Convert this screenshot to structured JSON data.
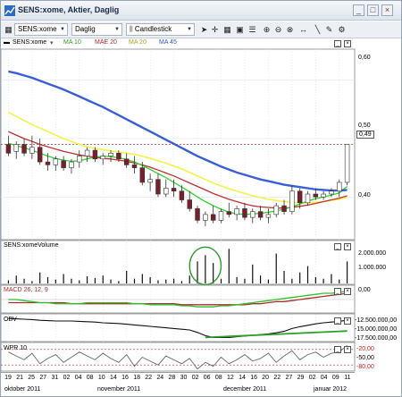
{
  "window": {
    "title": "SENS:xome, Aktier, Daglig",
    "minimize": "_",
    "maximize": "□",
    "close": "×"
  },
  "toolbar": {
    "symbol_value": "SENS:xome",
    "period_value": "Daglig",
    "chart_type_value": "Candlestick",
    "tool_icons": [
      "arrow-cursor-icon",
      "crosshair-icon",
      "grid-icon",
      "save-icon",
      "fields-icon",
      "zoom-in-icon",
      "zoom-out-icon",
      "zoom-fit-icon",
      "pan-icon",
      "trendline-icon",
      "draw-icon",
      "settings-icon"
    ]
  },
  "price_panel": {
    "legend": {
      "symbol": "SENS:xome",
      "ma10": "MA 10",
      "mae20": "MAE 20",
      "ma20": "MA 20",
      "ma45": "MA 45"
    },
    "colors": {
      "ma10": "#2fd22f",
      "mae20": "#c03030",
      "ma20": "#f2f24a",
      "ma45": "#3a5ed6",
      "candle_up": "#ffffff",
      "candle_down": "#7a1f2a",
      "hline": "#c03030"
    },
    "y_labels": [
      "0,60",
      "0,50",
      "0,40"
    ],
    "last_price": "0,49",
    "hline_level": 0.49
  },
  "volume_panel": {
    "label": "SENS:xomeVolume",
    "y_labels": [
      "2.000.000",
      "1.000.000"
    ],
    "highlight_color": "#2a9a2a"
  },
  "macd_panel": {
    "label": "MACD 26, 12, 9",
    "y_labels": [
      "0,00"
    ],
    "colors": {
      "macd": "#30c030",
      "signal": "#a83232"
    }
  },
  "obv_panel": {
    "label": "OBV",
    "y_labels": [
      "-12.500.000,00",
      "-15.000.000,00",
      "-17.500.000,00"
    ]
  },
  "wpr_panel": {
    "label": "WPR 10",
    "y_labels": [
      "-20,00",
      "-50,00",
      "-80,00"
    ]
  },
  "x_axis": {
    "days": [
      "19",
      "21",
      "25",
      "27",
      "31",
      "02",
      "04",
      "08",
      "10",
      "14",
      "16",
      "18",
      "22",
      "24",
      "28",
      "30",
      "02",
      "06",
      "08",
      "12",
      "14",
      "16",
      "20",
      "22",
      "27",
      "29",
      "02",
      "04",
      "09",
      "11"
    ],
    "months": [
      "oktober 2011",
      "november 2011",
      "december 2011",
      "januar 2012"
    ]
  },
  "chart_data": {
    "type": "candlestick",
    "price_ylim": [
      0.33,
      0.65
    ],
    "candles": [
      {
        "o": 0.49,
        "h": 0.505,
        "l": 0.47,
        "c": 0.475
      },
      {
        "o": 0.478,
        "h": 0.495,
        "l": 0.465,
        "c": 0.49
      },
      {
        "o": 0.49,
        "h": 0.5,
        "l": 0.47,
        "c": 0.475
      },
      {
        "o": 0.475,
        "h": 0.505,
        "l": 0.465,
        "c": 0.485
      },
      {
        "o": 0.485,
        "h": 0.5,
        "l": 0.455,
        "c": 0.46
      },
      {
        "o": 0.46,
        "h": 0.475,
        "l": 0.445,
        "c": 0.455
      },
      {
        "o": 0.455,
        "h": 0.47,
        "l": 0.445,
        "c": 0.465
      },
      {
        "o": 0.462,
        "h": 0.47,
        "l": 0.445,
        "c": 0.45
      },
      {
        "o": 0.45,
        "h": 0.465,
        "l": 0.44,
        "c": 0.46
      },
      {
        "o": 0.46,
        "h": 0.48,
        "l": 0.45,
        "c": 0.47
      },
      {
        "o": 0.47,
        "h": 0.485,
        "l": 0.46,
        "c": 0.48
      },
      {
        "o": 0.48,
        "h": 0.485,
        "l": 0.46,
        "c": 0.465
      },
      {
        "o": 0.465,
        "h": 0.475,
        "l": 0.455,
        "c": 0.47
      },
      {
        "o": 0.47,
        "h": 0.48,
        "l": 0.46,
        "c": 0.475
      },
      {
        "o": 0.475,
        "h": 0.48,
        "l": 0.46,
        "c": 0.465
      },
      {
        "o": 0.465,
        "h": 0.475,
        "l": 0.45,
        "c": 0.455
      },
      {
        "o": 0.455,
        "h": 0.47,
        "l": 0.44,
        "c": 0.45
      },
      {
        "o": 0.45,
        "h": 0.46,
        "l": 0.42,
        "c": 0.425
      },
      {
        "o": 0.425,
        "h": 0.44,
        "l": 0.41,
        "c": 0.43
      },
      {
        "o": 0.43,
        "h": 0.44,
        "l": 0.4,
        "c": 0.405
      },
      {
        "o": 0.405,
        "h": 0.43,
        "l": 0.4,
        "c": 0.415
      },
      {
        "o": 0.415,
        "h": 0.43,
        "l": 0.4,
        "c": 0.41
      },
      {
        "o": 0.41,
        "h": 0.42,
        "l": 0.39,
        "c": 0.395
      },
      {
        "o": 0.395,
        "h": 0.41,
        "l": 0.375,
        "c": 0.38
      },
      {
        "o": 0.38,
        "h": 0.385,
        "l": 0.355,
        "c": 0.36
      },
      {
        "o": 0.36,
        "h": 0.375,
        "l": 0.35,
        "c": 0.37
      },
      {
        "o": 0.37,
        "h": 0.385,
        "l": 0.355,
        "c": 0.36
      },
      {
        "o": 0.36,
        "h": 0.38,
        "l": 0.355,
        "c": 0.375
      },
      {
        "o": 0.375,
        "h": 0.39,
        "l": 0.365,
        "c": 0.37
      },
      {
        "o": 0.37,
        "h": 0.385,
        "l": 0.36,
        "c": 0.38
      },
      {
        "o": 0.38,
        "h": 0.39,
        "l": 0.36,
        "c": 0.365
      },
      {
        "o": 0.365,
        "h": 0.38,
        "l": 0.355,
        "c": 0.375
      },
      {
        "o": 0.375,
        "h": 0.385,
        "l": 0.36,
        "c": 0.365
      },
      {
        "o": 0.365,
        "h": 0.38,
        "l": 0.355,
        "c": 0.37
      },
      {
        "o": 0.37,
        "h": 0.39,
        "l": 0.365,
        "c": 0.385
      },
      {
        "o": 0.385,
        "h": 0.395,
        "l": 0.37,
        "c": 0.375
      },
      {
        "o": 0.375,
        "h": 0.42,
        "l": 0.37,
        "c": 0.41
      },
      {
        "o": 0.41,
        "h": 0.415,
        "l": 0.38,
        "c": 0.39
      },
      {
        "o": 0.39,
        "h": 0.41,
        "l": 0.385,
        "c": 0.405
      },
      {
        "o": 0.405,
        "h": 0.415,
        "l": 0.395,
        "c": 0.4
      },
      {
        "o": 0.4,
        "h": 0.41,
        "l": 0.395,
        "c": 0.405
      },
      {
        "o": 0.405,
        "h": 0.415,
        "l": 0.4,
        "c": 0.41
      },
      {
        "o": 0.41,
        "h": 0.43,
        "l": 0.4,
        "c": 0.425
      },
      {
        "o": 0.425,
        "h": 0.49,
        "l": 0.42,
        "c": 0.49
      }
    ],
    "ma45": [
      0.615,
      0.612,
      0.608,
      0.604,
      0.599,
      0.594,
      0.589,
      0.584,
      0.578,
      0.572,
      0.566,
      0.56,
      0.554,
      0.547,
      0.54,
      0.533,
      0.526,
      0.519,
      0.512,
      0.505,
      0.498,
      0.491,
      0.484,
      0.477,
      0.47,
      0.464,
      0.458,
      0.452,
      0.447,
      0.442,
      0.438,
      0.434,
      0.43,
      0.427,
      0.424,
      0.421,
      0.419,
      0.417,
      0.415,
      0.413,
      0.412,
      0.411,
      0.411,
      0.412
    ],
    "ma20": [
      0.545,
      0.538,
      0.531,
      0.524,
      0.518,
      0.512,
      0.506,
      0.5,
      0.495,
      0.49,
      0.486,
      0.483,
      0.481,
      0.479,
      0.477,
      0.475,
      0.473,
      0.47,
      0.466,
      0.462,
      0.458,
      0.453,
      0.448,
      0.442,
      0.436,
      0.43,
      0.424,
      0.419,
      0.414,
      0.41,
      0.406,
      0.402,
      0.399,
      0.396,
      0.394,
      0.392,
      0.391,
      0.39,
      0.39,
      0.391,
      0.392,
      0.394,
      0.396,
      0.399
    ],
    "mae20": [
      0.512,
      0.506,
      0.5,
      0.495,
      0.49,
      0.486,
      0.482,
      0.478,
      0.475,
      0.472,
      0.47,
      0.468,
      0.466,
      0.465,
      0.463,
      0.461,
      0.458,
      0.455,
      0.451,
      0.446,
      0.441,
      0.436,
      0.43,
      0.424,
      0.418,
      0.412,
      0.406,
      0.401,
      0.396,
      0.392,
      0.388,
      0.385,
      0.383,
      0.382,
      0.381,
      0.381,
      0.382,
      0.384,
      0.386,
      0.389,
      0.392,
      0.395,
      0.398,
      0.402
    ],
    "ma10": [
      0.492,
      0.488,
      0.484,
      0.48,
      0.475,
      0.47,
      0.466,
      0.463,
      0.461,
      0.462,
      0.465,
      0.468,
      0.47,
      0.469,
      0.467,
      0.464,
      0.46,
      0.454,
      0.447,
      0.44,
      0.433,
      0.425,
      0.417,
      0.409,
      0.4,
      0.392,
      0.385,
      0.379,
      0.374,
      0.371,
      0.37,
      0.371,
      0.372,
      0.374,
      0.376,
      0.379,
      0.383,
      0.388,
      0.393,
      0.397,
      0.4,
      0.403,
      0.407,
      0.418
    ],
    "volume_ylim": [
      0,
      2500000
    ],
    "volume": [
      200000,
      500000,
      300000,
      150000,
      700000,
      400000,
      250000,
      600000,
      300000,
      200000,
      450000,
      350000,
      500000,
      250000,
      150000,
      800000,
      300000,
      600000,
      400000,
      200000,
      250000,
      300000,
      150000,
      500000,
      1400000,
      1800000,
      1300000,
      300000,
      2200000,
      400000,
      300000,
      1200000,
      500000,
      250000,
      1900000,
      800000,
      300000,
      700000,
      1100000,
      400000,
      300000,
      600000,
      250000,
      1400000
    ],
    "macd": [
      0.0,
      0.0,
      -0.001,
      -0.002,
      -0.003,
      -0.003,
      -0.004,
      -0.004,
      -0.004,
      -0.004,
      -0.003,
      -0.003,
      -0.003,
      -0.003,
      -0.003,
      -0.003,
      -0.004,
      -0.004,
      -0.005,
      -0.005,
      -0.005,
      -0.005,
      -0.006,
      -0.006,
      -0.007,
      -0.007,
      -0.007,
      -0.006,
      -0.006,
      -0.005,
      -0.004,
      -0.003,
      -0.002,
      -0.001,
      0.0,
      0.001,
      0.002,
      0.003,
      0.004,
      0.005,
      0.006,
      0.006,
      0.007,
      0.008
    ],
    "signal": [
      -0.003,
      -0.003,
      -0.003,
      -0.003,
      -0.003,
      -0.003,
      -0.003,
      -0.003,
      -0.004,
      -0.004,
      -0.004,
      -0.004,
      -0.004,
      -0.004,
      -0.004,
      -0.004,
      -0.004,
      -0.004,
      -0.004,
      -0.004,
      -0.004,
      -0.004,
      -0.005,
      -0.005,
      -0.005,
      -0.005,
      -0.005,
      -0.005,
      -0.005,
      -0.005,
      -0.005,
      -0.004,
      -0.004,
      -0.003,
      -0.002,
      -0.002,
      -0.001,
      0.0,
      0.001,
      0.002,
      0.003,
      0.004,
      0.005,
      0.006
    ],
    "macd_ylim": [
      -0.012,
      0.012
    ],
    "obv": [
      -12300000,
      -12400000,
      -12500000,
      -12600000,
      -12800000,
      -12900000,
      -13000000,
      -13000000,
      -13000000,
      -13100000,
      -13200000,
      -13300000,
      -13500000,
      -13600000,
      -13700000,
      -13900000,
      -14100000,
      -14300000,
      -14500000,
      -14700000,
      -14900000,
      -15100000,
      -15300000,
      -15500000,
      -16200000,
      -17100000,
      -17600000,
      -17600000,
      -17600000,
      -17400000,
      -17200000,
      -17000000,
      -16800000,
      -16600000,
      -16300000,
      -15900000,
      -15100000,
      -14600000,
      -14200000,
      -13800000,
      -13500000,
      -13300000,
      -13100000,
      -12800000
    ],
    "obv_trend": [
      -17600000,
      -15800000
    ],
    "obv_ylim": [
      -18500000,
      -11500000
    ],
    "wpr": [
      -30,
      -45,
      -60,
      -35,
      -75,
      -55,
      -40,
      -70,
      -50,
      -30,
      -45,
      -60,
      -35,
      -55,
      -70,
      -40,
      -85,
      -50,
      -65,
      -80,
      -45,
      -60,
      -75,
      -55,
      -95,
      -70,
      -85,
      -50,
      -75,
      -60,
      -40,
      -65,
      -55,
      -35,
      -70,
      -45,
      -25,
      -60,
      -40,
      -30,
      -50,
      -35,
      -30,
      -5
    ],
    "wpr_ylim": [
      -100,
      0
    ]
  }
}
